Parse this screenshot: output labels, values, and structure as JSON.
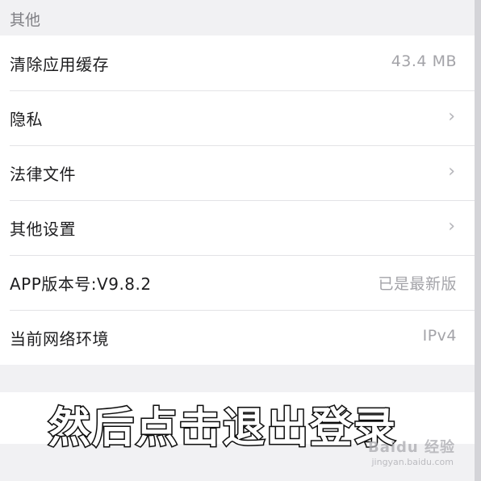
{
  "section": {
    "title": "其他"
  },
  "rows": [
    {
      "label": "清除应用缓存",
      "value": "43.4 MB",
      "chevron": false
    },
    {
      "label": "隐私",
      "value": "",
      "chevron": true
    },
    {
      "label": "法律文件",
      "value": "",
      "chevron": true
    },
    {
      "label": "其他设置",
      "value": "",
      "chevron": true
    },
    {
      "label": "APP版本号:V9.8.2",
      "value": "已是最新版",
      "chevron": false
    },
    {
      "label": "当前网络环境",
      "value": "IPv4",
      "chevron": false
    }
  ],
  "chevron_glyph": "›",
  "overlay": {
    "subtitle": "然后点击退出登录"
  },
  "watermark": {
    "brand": "Baidu 经验",
    "url": "jingyan.baidu.com"
  },
  "colors": {
    "background": "#f1f1f3",
    "cell": "#ffffff",
    "label": "#1d1d1f",
    "secondary": "#a3a3a8",
    "subtitle_fill": "#ffffff",
    "subtitle_stroke": "#111111"
  }
}
